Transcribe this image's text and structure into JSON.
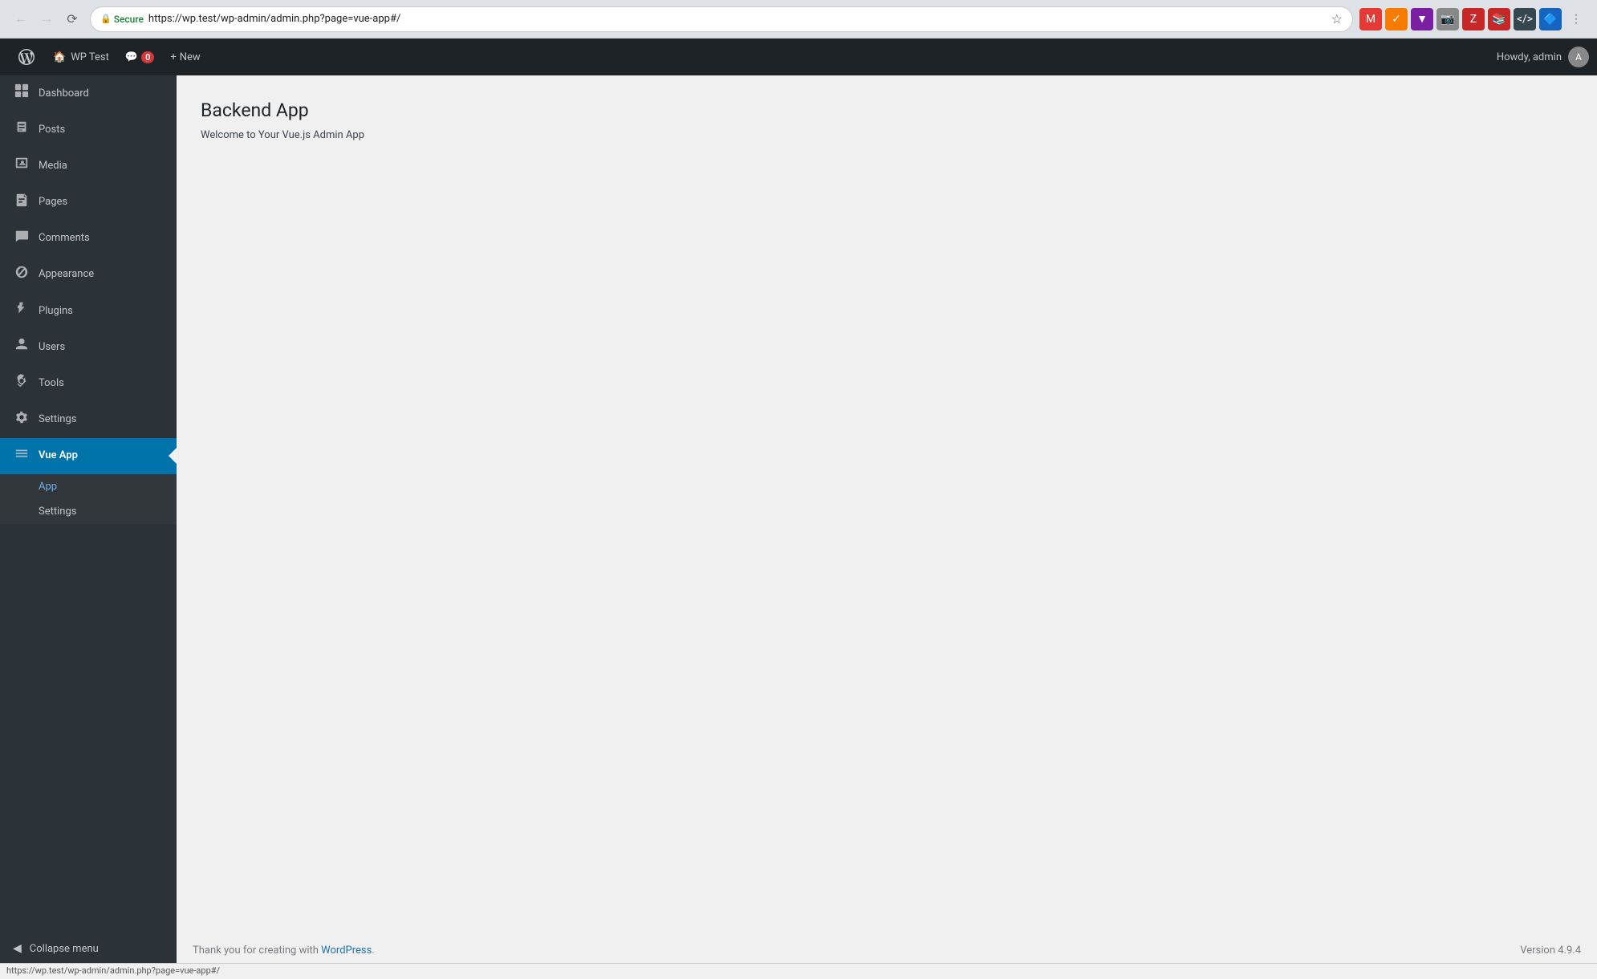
{
  "browser": {
    "url": "https://wp.test/wp-admin/admin.php?page=vue-app#/",
    "secure_label": "Secure",
    "status_url": "https://wp.test/wp-admin/admin.php?page=vue-app#/"
  },
  "admin_bar": {
    "site_name": "WP Test",
    "comments_count": "0",
    "new_label": "New",
    "howdy": "Howdy, admin"
  },
  "sidebar": {
    "items": [
      {
        "id": "dashboard",
        "label": "Dashboard",
        "icon": "⊞"
      },
      {
        "id": "posts",
        "label": "Posts",
        "icon": "📝"
      },
      {
        "id": "media",
        "label": "Media",
        "icon": "🖼"
      },
      {
        "id": "pages",
        "label": "Pages",
        "icon": "📄"
      },
      {
        "id": "comments",
        "label": "Comments",
        "icon": "💬"
      },
      {
        "id": "appearance",
        "label": "Appearance",
        "icon": "🎨"
      },
      {
        "id": "plugins",
        "label": "Plugins",
        "icon": "🔌"
      },
      {
        "id": "users",
        "label": "Users",
        "icon": "👤"
      },
      {
        "id": "tools",
        "label": "Tools",
        "icon": "🔧"
      },
      {
        "id": "settings",
        "label": "Settings",
        "icon": "⊞"
      },
      {
        "id": "vue-app",
        "label": "Vue App",
        "icon": "☰"
      }
    ],
    "submenu": [
      {
        "id": "app",
        "label": "App",
        "active": true
      },
      {
        "id": "vue-settings",
        "label": "Settings",
        "active": false
      }
    ],
    "collapse_label": "Collapse menu"
  },
  "main": {
    "title": "Backend App",
    "subtitle": "Welcome to Your Vue.js Admin App"
  },
  "footer": {
    "left_text": "Thank you for creating with ",
    "wp_link": "WordPress",
    "wp_url": "#",
    "left_suffix": ".",
    "version": "Version 4.9.4"
  }
}
